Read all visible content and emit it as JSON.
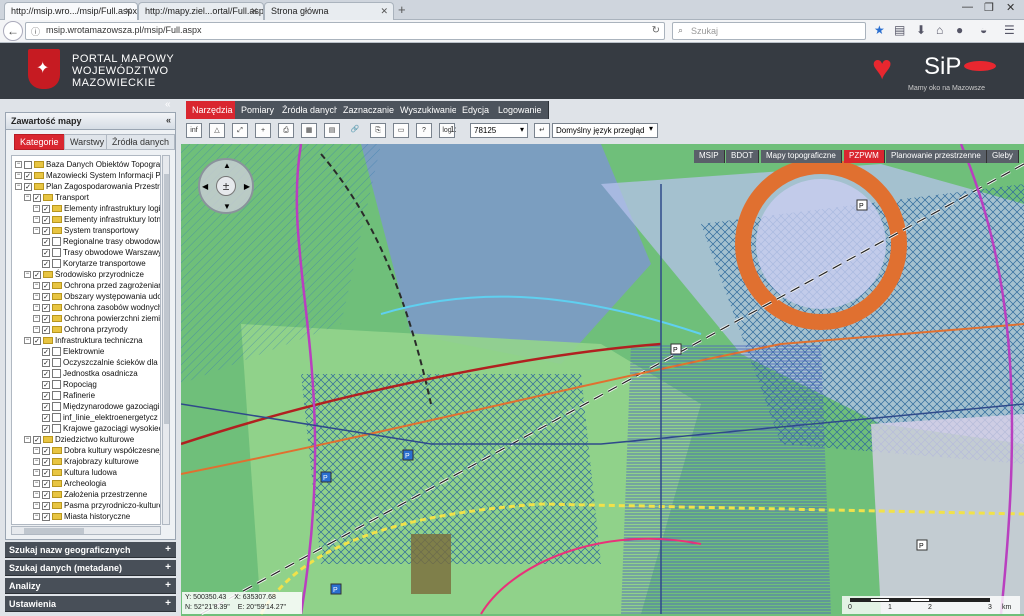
{
  "browser": {
    "tabs": [
      {
        "title": "http://msip.wro.../msip/Full.aspx",
        "active": true
      },
      {
        "title": "http://mapy.ziel...ortal/Full.aspx",
        "active": false
      },
      {
        "title": "Strona główna",
        "active": false
      }
    ],
    "url": "msip.wrotamazowsza.pl/msip/Full.aspx",
    "search_placeholder": "Szukaj"
  },
  "header": {
    "portal_line1": "PORTAL MAPOWY",
    "portal_line2": "WOJEWÓDZTWO",
    "portal_line3": "MAZOWIECKIE",
    "sip_logo": "SiP",
    "sip_tagline": "Mamy oko na Mazowsze"
  },
  "left_panel": {
    "title": "Zawartość mapy",
    "tabs": [
      "Kategorie",
      "Warstwy",
      "Źródła danych"
    ],
    "tree": [
      {
        "label": "Baza Danych Obiektów Topografic",
        "level": 0,
        "type": "folder",
        "checked": false
      },
      {
        "label": "Mazowiecki System Informacji Prz",
        "level": 0,
        "type": "folder",
        "checked": true
      },
      {
        "label": "Plan Zagospodarowania Przestrze",
        "level": 0,
        "type": "folder",
        "checked": true
      },
      {
        "label": "Transport",
        "level": 1,
        "type": "folder",
        "checked": true
      },
      {
        "label": "Elementy infrastruktury logis",
        "level": 2,
        "type": "folder",
        "checked": true
      },
      {
        "label": "Elementy infrastruktury lotni",
        "level": 2,
        "type": "folder",
        "checked": true
      },
      {
        "label": "System transportowy",
        "level": 2,
        "type": "folder",
        "checked": true
      },
      {
        "label": "Regionalne trasy obwodowe",
        "level": 3,
        "type": "leaf",
        "checked": true
      },
      {
        "label": "Trasy obwodowe Warszawy",
        "level": 3,
        "type": "leaf",
        "checked": true
      },
      {
        "label": "Korytarze transportowe",
        "level": 3,
        "type": "leaf",
        "checked": true
      },
      {
        "label": "Środowisko przyrodnicze",
        "level": 1,
        "type": "folder",
        "checked": true
      },
      {
        "label": "Ochrona przed zagrożeniam",
        "level": 2,
        "type": "folder",
        "checked": true
      },
      {
        "label": "Obszary występowania udok",
        "level": 2,
        "type": "folder",
        "checked": true
      },
      {
        "label": "Ochrona zasobów wodnych",
        "level": 2,
        "type": "folder",
        "checked": true
      },
      {
        "label": "Ochrona powierzchni ziemi",
        "level": 2,
        "type": "folder",
        "checked": true
      },
      {
        "label": "Ochrona przyrody",
        "level": 2,
        "type": "folder",
        "checked": true
      },
      {
        "label": "Infrastruktura techniczna",
        "level": 1,
        "type": "folder",
        "checked": true
      },
      {
        "label": "Elektrownie",
        "level": 3,
        "type": "leaf",
        "checked": true
      },
      {
        "label": "Oczyszczalnie ścieków dla a",
        "level": 3,
        "type": "leaf",
        "checked": true
      },
      {
        "label": "Jednostka osadnicza",
        "level": 3,
        "type": "leaf",
        "checked": true
      },
      {
        "label": "Ropociąg",
        "level": 3,
        "type": "leaf",
        "checked": true
      },
      {
        "label": "Rafinerie",
        "level": 3,
        "type": "leaf",
        "checked": true
      },
      {
        "label": "Międzynarodowe gazociągi w",
        "level": 3,
        "type": "leaf",
        "checked": true
      },
      {
        "label": "inf_linie_elektroenergetycz",
        "level": 3,
        "type": "leaf",
        "checked": true
      },
      {
        "label": "Krajowe gazociągi wysokiec",
        "level": 3,
        "type": "leaf",
        "checked": true
      },
      {
        "label": "Dziedzictwo kulturowe",
        "level": 1,
        "type": "folder",
        "checked": true
      },
      {
        "label": "Dobra kultury współczesnej",
        "level": 2,
        "type": "folder",
        "checked": true
      },
      {
        "label": "Krajobrazy kulturowe",
        "level": 2,
        "type": "folder",
        "checked": true
      },
      {
        "label": "Kultura ludowa",
        "level": 2,
        "type": "folder",
        "checked": true
      },
      {
        "label": "Archeologia",
        "level": 2,
        "type": "folder",
        "checked": true
      },
      {
        "label": "Założenia przestrzenne",
        "level": 2,
        "type": "folder",
        "checked": true
      },
      {
        "label": "Pasma przyrodniczo-kulturo",
        "level": 2,
        "type": "folder",
        "checked": true
      },
      {
        "label": "Miasta historyczne",
        "level": 2,
        "type": "folder",
        "checked": true
      }
    ],
    "accordions": [
      "Szukaj nazw geograficznych",
      "Szukaj danych (metadane)",
      "Analizy",
      "Ustawienia"
    ]
  },
  "menu": [
    "Narzędzia",
    "Pomiary",
    "Źródła danych",
    "Zaznaczanie",
    "Wyszukiwanie",
    "Edycja",
    "Logowanie"
  ],
  "toolbar": {
    "buttons": [
      "info",
      "measure",
      "extent",
      "zoom-in",
      "print",
      "chart",
      "table",
      "link",
      "export",
      "help",
      "log"
    ],
    "scale_prefix": "1:",
    "scale_value": "78125",
    "language": "Domyślny język przegląd"
  },
  "map": {
    "tabs": [
      "MSIP",
      "BDOT",
      "Mapy topograficzne",
      "PZPWM",
      "Planowanie przestrzenne",
      "Gleby"
    ],
    "active_tab": "PZPWM",
    "coords": {
      "y": "Y: 500350.43",
      "x": "X: 635307.68",
      "n": "N: 52°21'8.39\"",
      "e": "E: 20°59'14.27\""
    },
    "scalebar_labels": [
      "0",
      "1",
      "2",
      "3",
      "km"
    ],
    "map_labels": [
      "P",
      "P",
      "P",
      "P",
      "P",
      "P"
    ],
    "colors": {
      "green": "#6fbf7a",
      "blue": "#7f93d8",
      "orange": "#e07030",
      "purple": "#b93fbf",
      "yellow": "#f1e24a",
      "red": "#d9262f"
    }
  }
}
